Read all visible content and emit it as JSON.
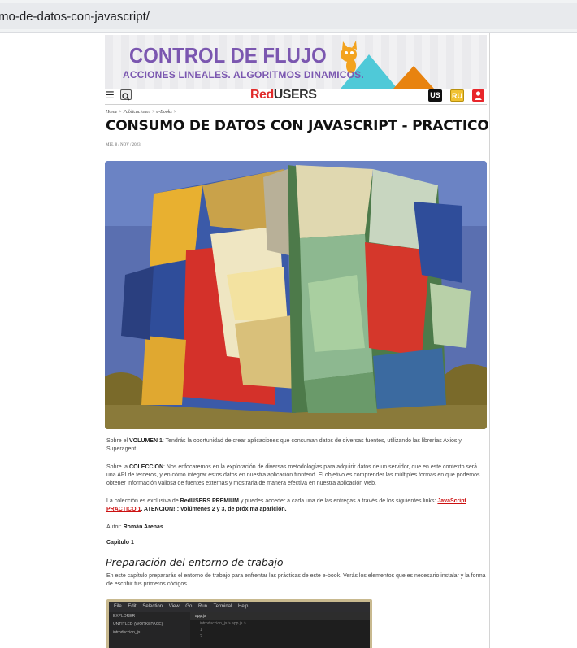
{
  "browser": {
    "url": "mo-de-datos-con-javascript/"
  },
  "banner": {
    "title": "CONTROL DE FLUJO",
    "subtitle": "ACCIONES LINEALES. ALGORITMOS DINAMICOS.",
    "colors": {
      "purple": "#7b57b0",
      "teal": "#4fc9d8",
      "orange": "#e8830f",
      "cat": "#f3a31f"
    }
  },
  "navbar": {
    "logo_red": "Red",
    "logo_dark": "USERS",
    "us_badge": "US",
    "ru_badge": "RU",
    "menu_icon": "hamburger-icon",
    "search_icon": "search-icon",
    "user_icon": "user-icon"
  },
  "article": {
    "breadcrumb": "Home > Publicaciones > e-Books >",
    "title": "CONSUMO DE DATOS CON JAVASCRIPT - PRACTICO",
    "date": "MIE, 8 / NOV / 2023",
    "p1_prefix": "Sobre el ",
    "p1_bold": "VOLUMEN 1",
    "p1_text": ": Tendrás la oportunidad de crear aplicaciones que consuman datos de diversas fuentes, utilizando las librerías Axios y Superagent.",
    "p2_prefix": "Sobre la ",
    "p2_bold": "COLECCION",
    "p2_text": ": Nos enfocaremos en la exploración de diversas metodologías para adquirir datos de un servidor, que en este contexto será una API de terceros, y en cómo integrar estos datos en nuestra aplicación frontend. El objetivo es comprender las múltiples formas en que podemos obtener información valiosa de fuentes externas y mostrarla de manera efectiva en nuestra aplicación web.",
    "p3_prefix": "La colección es exclusiva de ",
    "p3_bold": "RedUSERS PREMIUM",
    "p3_text": " y puedes acceder a cada una de las entregas a través de los siguientes links: ",
    "p3_link": "JavaScript PRACTICO 1",
    "p3_suffix": ". ATENCION!!: Volúmenes 2 y 3, de próxima aparición.",
    "author_label": "Autor: ",
    "author": "Román Arenas",
    "chapter": "Capitulo 1",
    "section_title": "Preparación del entorno de trabajo",
    "section_text": "En este capítulo prepararás el entorno de trabajo para enfrentar las prácticas de este e-book. Verás los elementos que es necesario instalar y la forma de escribir tus primeros códigos."
  },
  "editor_shot": {
    "menu": [
      "File",
      "Edit",
      "Selection",
      "View",
      "Go",
      "Run",
      "Terminal",
      "Help"
    ],
    "explorer": "EXPLORER",
    "workspace": "UNTITLED (WORKSPACE)",
    "folder": "introduccion_js",
    "tab": "app.js",
    "breadcrumb": "introduccion_js > app.js > ...",
    "lines": [
      "1",
      "2"
    ]
  }
}
